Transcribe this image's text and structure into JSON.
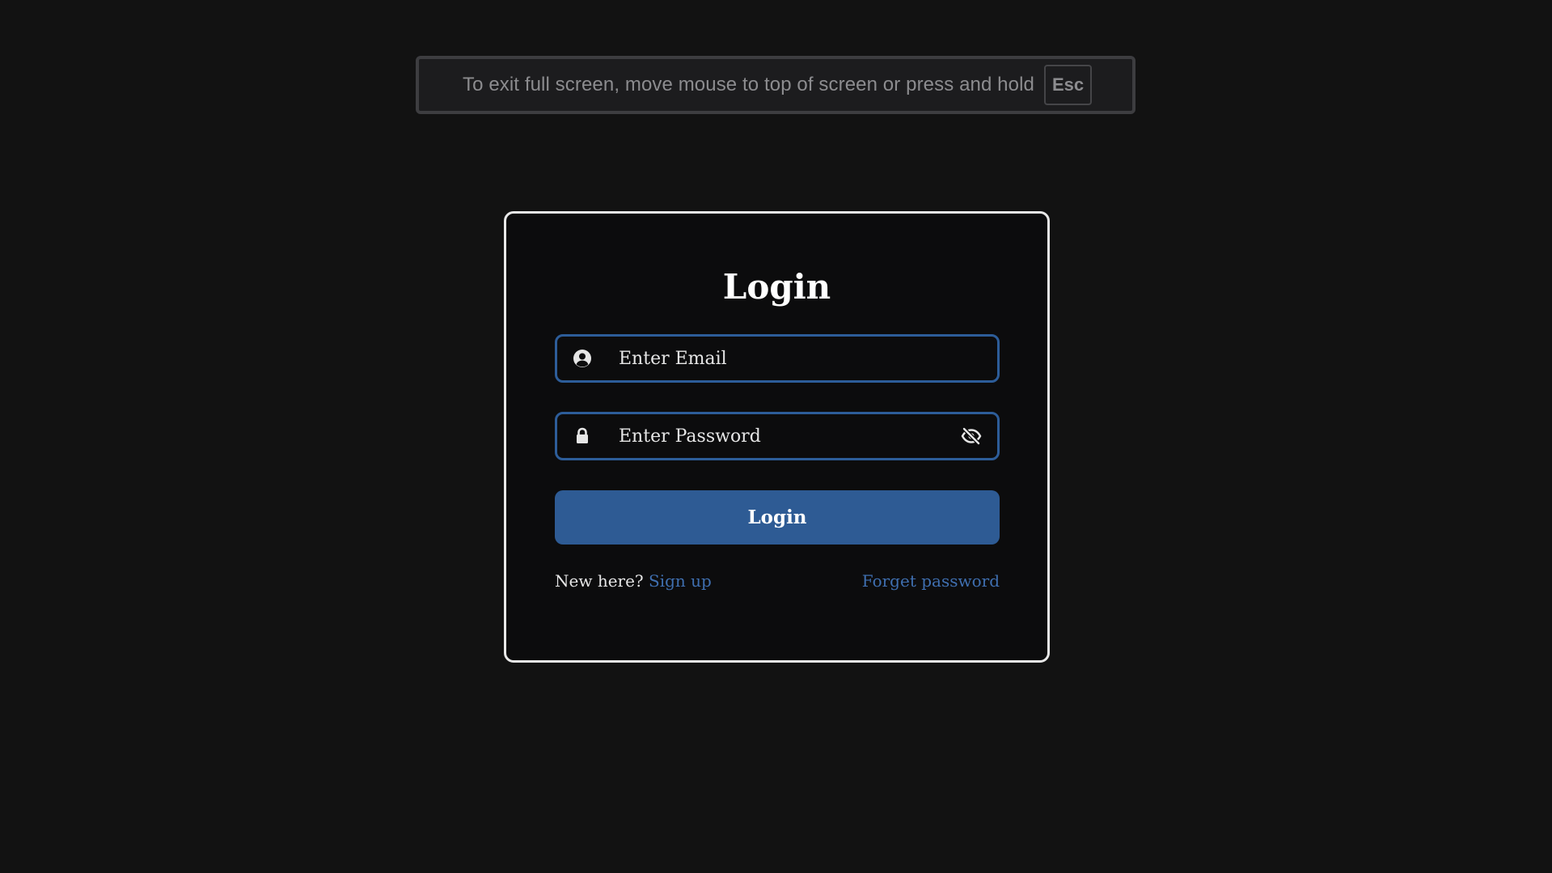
{
  "fullscreen_notice": {
    "text": "To exit full screen, move mouse to top of screen or press and hold",
    "key": "Esc"
  },
  "login_card": {
    "title": "Login",
    "email": {
      "placeholder": "Enter Email",
      "value": "",
      "icon": "user-circle-icon"
    },
    "password": {
      "placeholder": "Enter Password",
      "value": "",
      "icon": "lock-icon",
      "toggle_icon": "eye-slash-icon"
    },
    "submit_label": "Login",
    "new_here_text": "New here?",
    "signup_link": "Sign up",
    "forgot_link": "Forget password"
  },
  "colors": {
    "background": "#121212",
    "card_background": "#0c0c0d",
    "accent": "#2e5b94",
    "link": "#3f6fb0",
    "field_border": "#2d5d99"
  }
}
